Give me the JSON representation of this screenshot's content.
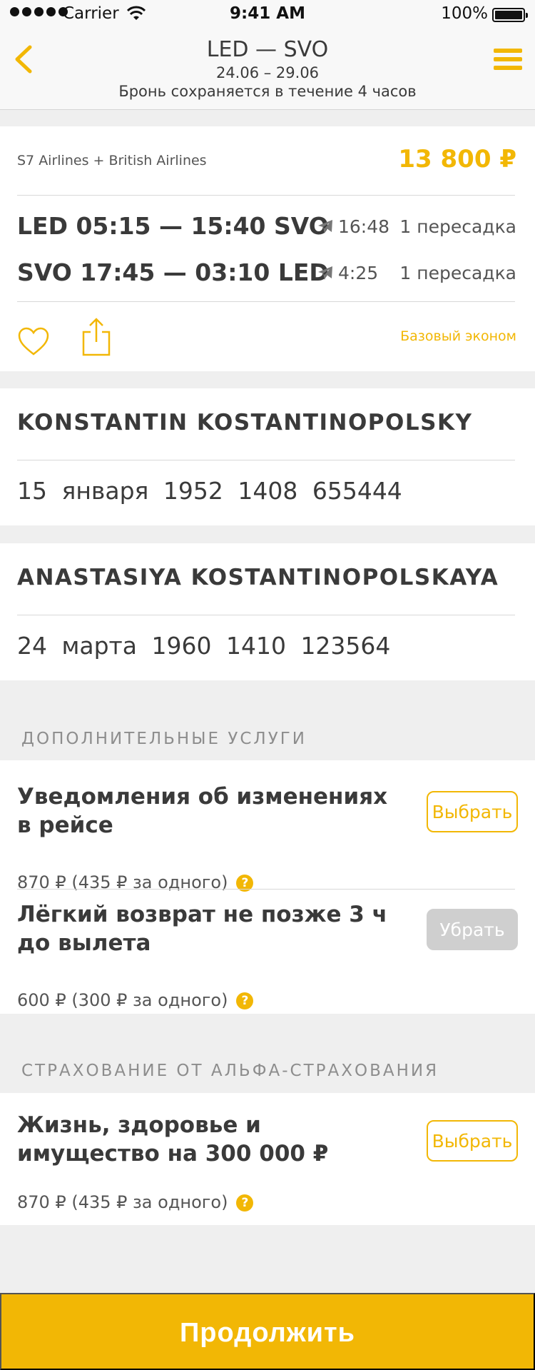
{
  "status_bar": {
    "carrier": "Carrier",
    "time": "9:41 AM",
    "battery": "100%"
  },
  "header": {
    "title": "LED — SVO",
    "dates": "24.06 – 29.06",
    "note": "Бронь сохраняется в течение 4 часов"
  },
  "flight": {
    "airlines": "S7 Airlines + British Airlines",
    "price": "13 800 ₽",
    "segments": [
      {
        "route": "LED 05:15 — 15:40 SVO",
        "duration": "16:48",
        "stops": "1 пересадка"
      },
      {
        "route": "SVO 17:45 — 03:10 LED",
        "duration": "4:25",
        "stops": "1 пересадка"
      }
    ],
    "fare": "Базовый эконом"
  },
  "passengers": [
    {
      "name": "KONSTANTIN KOSTANTINOPOLSKY",
      "birth": "15 января 1952",
      "document": "1408 655444"
    },
    {
      "name": "ANASTASIYA KOSTANTINOPOLSKAYA",
      "birth": "24 марта 1960",
      "document": "1410 123564"
    }
  ],
  "extras": {
    "section_title": "ДОПОЛНИТЕЛЬНЫЕ УСЛУГИ",
    "items": [
      {
        "title": "Уведомления об изменениях в рейсе",
        "price": "870 ₽ (435 ₽ за одного)",
        "button": "Выбрать",
        "state": "available"
      },
      {
        "title": "Лёгкий возврат не позже 3 ч до вылета",
        "price": "600 ₽ (300 ₽ за одного)",
        "button": "Убрать",
        "state": "selected"
      }
    ]
  },
  "insurance": {
    "section_title": "СТРАХОВАНИЕ ОТ АЛЬФА-СТРАХОВАНИЯ",
    "items": [
      {
        "title": "Жизнь, здоровье и имущество на 300 000 ₽",
        "price": "870 ₽ (435 ₽ за одного)",
        "button": "Выбрать",
        "state": "available"
      }
    ]
  },
  "help_glyph": "?",
  "continue_label": "Продолжить",
  "colors": {
    "accent": "#f2b705",
    "background": "#efefef",
    "text": "#3a3a3a",
    "disabled_button": "#cfcfcf"
  },
  "icons": [
    "back-chevron-icon",
    "menu-icon",
    "wifi-icon",
    "battery-icon",
    "plane-icon",
    "heart-icon",
    "share-icon",
    "help-icon"
  ]
}
